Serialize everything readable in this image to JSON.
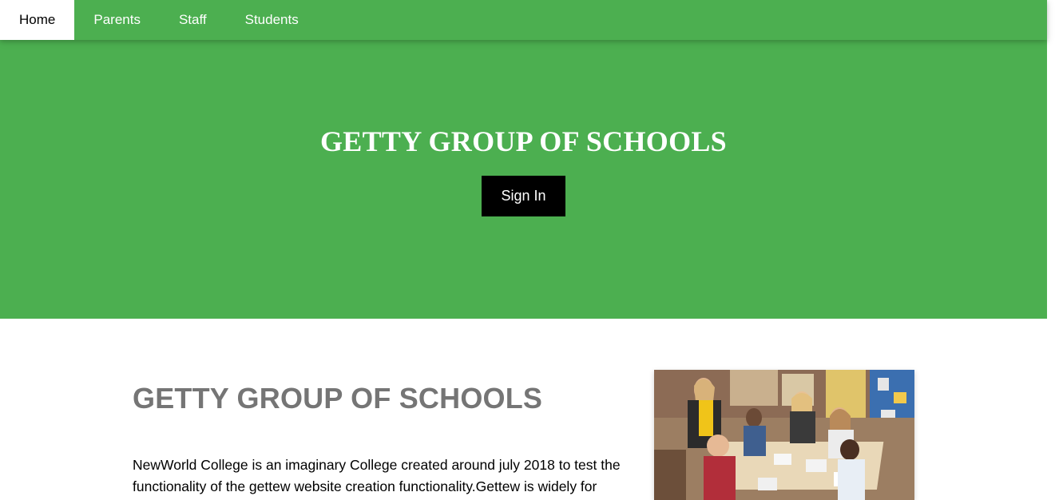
{
  "nav": {
    "items": [
      {
        "label": "Home",
        "active": true
      },
      {
        "label": "Parents",
        "active": false
      },
      {
        "label": "Staff",
        "active": false
      },
      {
        "label": "Students",
        "active": false
      }
    ]
  },
  "hero": {
    "title": "GETTY GROUP OF SCHOOLS",
    "signin_label": "Sign In"
  },
  "about": {
    "title": "GETTY GROUP OF SCHOOLS",
    "text": "NewWorld College is an imaginary College created around july 2018 to test the functionality of the gettew website creation functionality.Gettew is widely for"
  },
  "colors": {
    "brand_green": "#4caf50",
    "button_black": "#000000",
    "heading_gray": "#757575"
  }
}
